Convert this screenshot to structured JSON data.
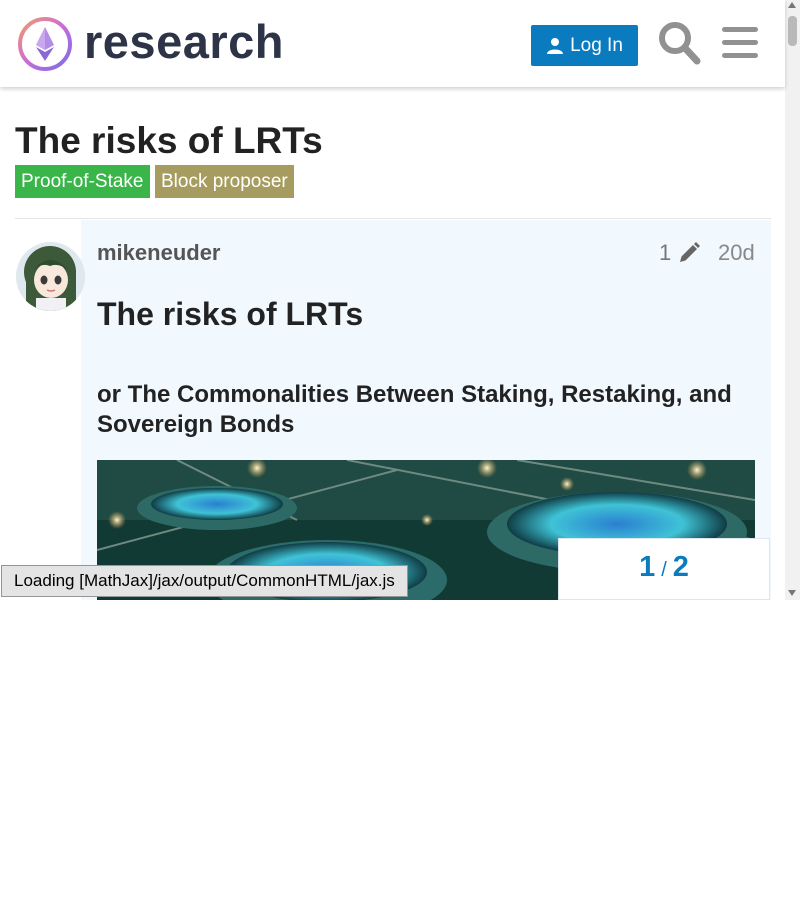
{
  "header": {
    "brand": "research",
    "login_label": "Log In",
    "icons": {
      "logo": "ethereum-research-logo",
      "login": "user-icon",
      "search": "search-icon",
      "menu": "hamburger-icon"
    },
    "accent_color": "#0a7bbf"
  },
  "topic": {
    "title": "The risks of LRTs",
    "tags": [
      {
        "label": "Proof-of-Stake",
        "color": "#3ab54a"
      },
      {
        "label": "Block proposer",
        "color": "#a79c5f"
      }
    ]
  },
  "post": {
    "username": "mikeneuder",
    "edit_count": "1",
    "age": "20d",
    "heading": "The risks of LRTs",
    "subheading": "or The Commonalities Between Staking, Restaking, and Sovereign Bonds",
    "icons": {
      "edit": "pencil-icon",
      "avatar": "anime-avatar"
    }
  },
  "status": {
    "mathjax_message": "Loading [MathJax]/jax/output/CommonHTML/jax.js"
  },
  "progress": {
    "current": "1",
    "separator": "/",
    "total": "2"
  }
}
